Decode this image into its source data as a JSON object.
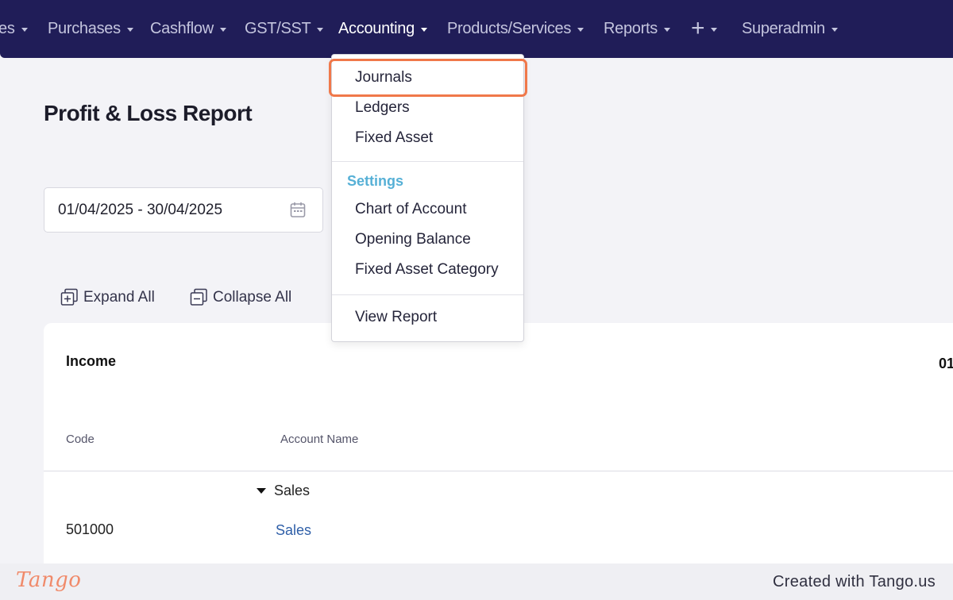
{
  "nav": {
    "items": [
      {
        "label": "es"
      },
      {
        "label": "Purchases"
      },
      {
        "label": "Cashflow"
      },
      {
        "label": "GST/SST"
      },
      {
        "label": "Accounting"
      },
      {
        "label": "Products/Services"
      },
      {
        "label": "Reports"
      },
      {
        "label": "+"
      },
      {
        "label": "Superadmin"
      }
    ],
    "active": "Accounting"
  },
  "page": {
    "title": "Profit & Loss Report",
    "date_range": "01/04/2025 - 30/04/2025",
    "expand_all": "Expand All",
    "collapse_all": "Collapse All"
  },
  "report": {
    "section": "Income",
    "period_partial": "01",
    "columns": {
      "code": "Code",
      "account_name": "Account Name"
    },
    "group": "Sales",
    "rows": [
      {
        "code": "501000",
        "name": "Sales"
      }
    ]
  },
  "dropdown": {
    "items": [
      "Journals",
      "Ledgers",
      "Fixed Asset"
    ],
    "settings_header": "Settings",
    "settings_items": [
      "Chart of Account",
      "Opening Balance",
      "Fixed Asset Category"
    ],
    "report_items": [
      "View Report"
    ],
    "highlighted": "Journals"
  },
  "footer": {
    "logo": "Tango",
    "credit": "Created with Tango.us"
  },
  "colors": {
    "navbar": "#201d58",
    "highlight": "#f0784a",
    "settings_header": "#56b0d6",
    "link": "#2f5fa8"
  }
}
